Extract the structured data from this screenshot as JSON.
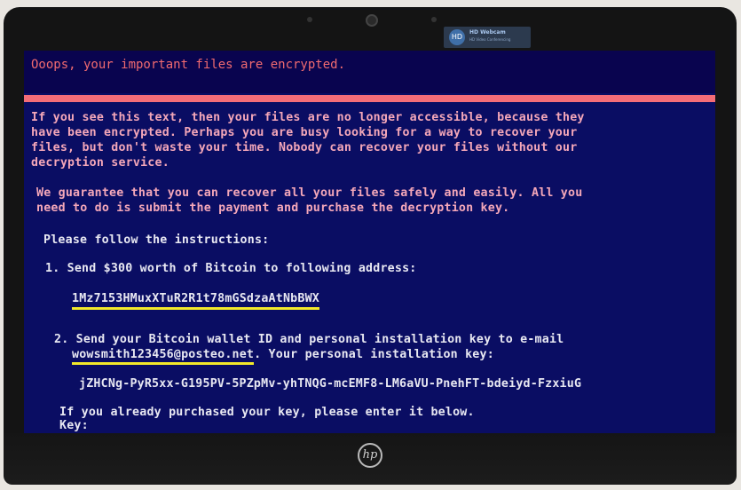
{
  "camera_overlay": {
    "title": "HD Webcam",
    "subtitle": "HD Video Conferencing",
    "icon": "webcam-icon"
  },
  "ransom": {
    "headline": "Ooops, your important files are encrypted.",
    "paragraph1": [
      "If you see this text, then your files are no longer accessible, because they",
      "have been encrypted.  Perhaps you are busy looking for a way to recover your",
      "files, but don't waste your time.  Nobody can recover your files without our",
      "decryption service."
    ],
    "paragraph2": [
      "We guarantee that you can recover all your files safely and easily.  All you",
      "need to do is submit the payment and purchase the decryption key."
    ],
    "instructions_heading": "Please follow the instructions:",
    "step1": "1. Send $300 worth of Bitcoin to following address:",
    "bitcoin_address": "1Mz7153HMuxXTuR2R1t78mGSdzaAtNbBWX",
    "step2_line1": "2. Send your Bitcoin wallet ID and personal installation key to e-mail",
    "email": "wowsmith123456@posteo.net",
    "step2_line2_rest": ". Your personal installation key:",
    "installation_key": "jZHCNg-PyR5xx-G195PV-5PZpMv-yhTNQG-mcEMF8-LM6aVU-PnehFT-bdeiyd-FzxiuG",
    "purchase_prompt": "If you already purchased your key, please enter it below.",
    "key_label": "Key:"
  },
  "device": {
    "logo": "hp-logo",
    "logo_text": "hp"
  },
  "colors": {
    "screen_bg": "#0a0d63",
    "red_text": "#f4a7b9",
    "white_text": "#e8e8f2",
    "accent_line": "#f46d78",
    "underline": "#f3e92a"
  }
}
